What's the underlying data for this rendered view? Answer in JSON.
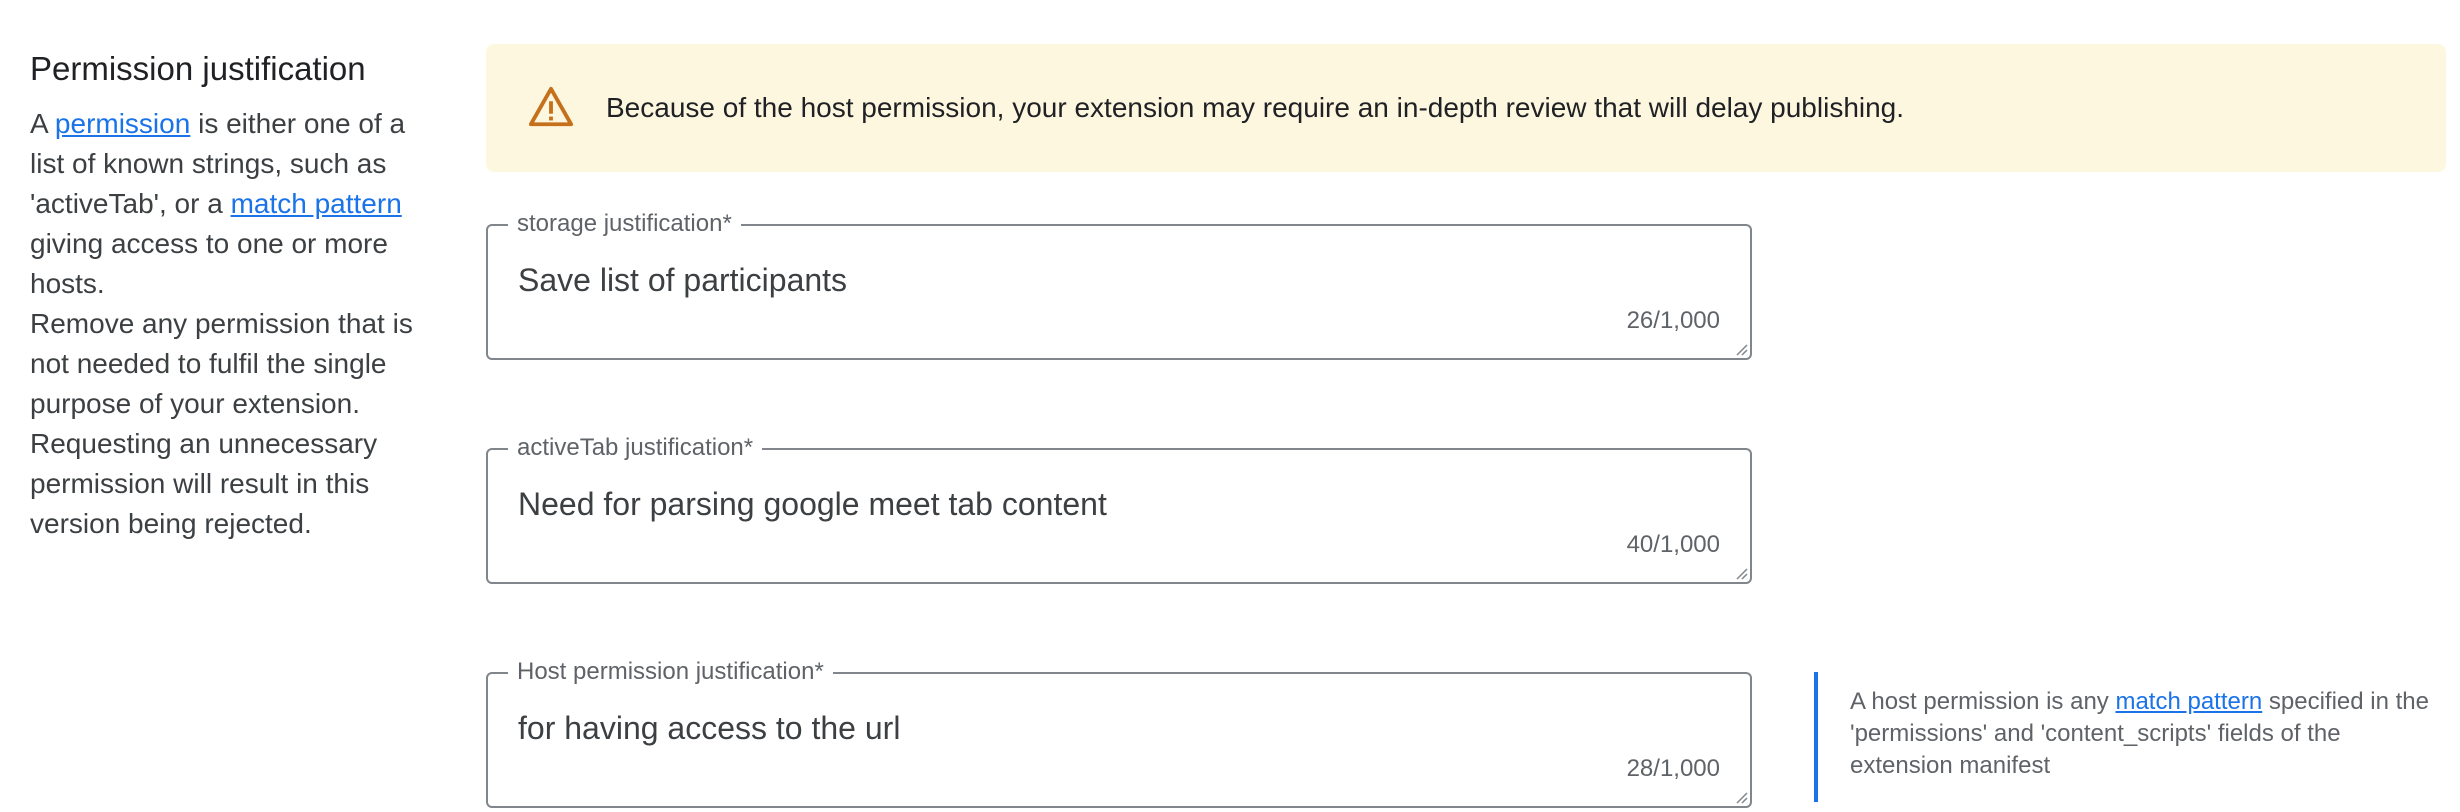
{
  "side": {
    "title": "Permission justification",
    "p1_prefix": "A ",
    "p1_link_permission": "permission",
    "p1_middle": " is either one of a list of known strings, such as 'activeTab', or a ",
    "p1_link_match": "match pattern",
    "p1_suffix": " giving access to one or more hosts.",
    "p2": "Remove any permission that is not needed to fulfil the single purpose of your extension. Requesting an unnecessary permission will result in this version being rejected."
  },
  "banner": {
    "icon": "warning-icon",
    "text": "Because of the host permission, your extension may require an in-depth review that will delay publishing.",
    "background": "#fef7e0",
    "icon_color": "#c5701a"
  },
  "fields": {
    "storage": {
      "label": "storage justification*",
      "value": "Save list of participants",
      "count": "26/1,000"
    },
    "activetab": {
      "label": "activeTab justification*",
      "value": "Need for parsing google meet tab content",
      "count": "40/1,000"
    },
    "host": {
      "label": "Host permission justification*",
      "value": "for having access to the url",
      "count": "28/1,000"
    }
  },
  "host_note": {
    "prefix": "A host permission is any ",
    "link": "match pattern",
    "suffix": " specified in the 'permissions' and 'content_scripts' fields of the extension manifest",
    "accent": "#1a73e8"
  },
  "colors": {
    "link": "#1a73e8",
    "field_border": "#80868b"
  }
}
